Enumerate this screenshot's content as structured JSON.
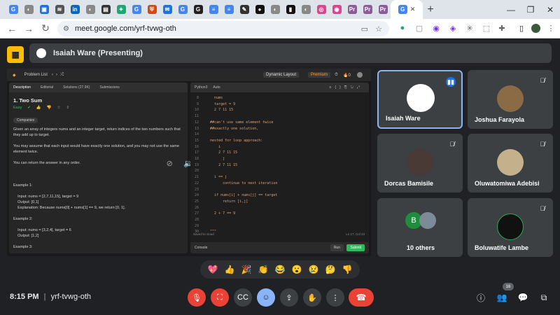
{
  "browser": {
    "tabs": [
      {
        "icon": "google-icon",
        "color": "#4285f4",
        "glyph": "G"
      },
      {
        "icon": "globe-icon",
        "color": "#888888",
        "glyph": "◐"
      },
      {
        "icon": "browser-icon",
        "color": "#1a73e8",
        "glyph": "▣"
      },
      {
        "icon": "wifi-icon",
        "color": "#555555",
        "glyph": "≋"
      },
      {
        "icon": "linkedin-icon",
        "color": "#0a66c2",
        "glyph": "in"
      },
      {
        "icon": "globe-icon",
        "color": "#888888",
        "glyph": "◐"
      },
      {
        "icon": "image-icon",
        "color": "#333333",
        "glyph": "▤"
      },
      {
        "icon": "sparkle-icon",
        "color": "#19a974",
        "glyph": "✦"
      },
      {
        "icon": "google-icon",
        "color": "#4285f4",
        "glyph": "G"
      },
      {
        "icon": "shield-icon",
        "color": "#d9480f",
        "glyph": "⛨"
      },
      {
        "icon": "mail-icon",
        "color": "#1a73e8",
        "glyph": "✉"
      },
      {
        "icon": "google-icon",
        "color": "#4285f4",
        "glyph": "G"
      },
      {
        "icon": "g-dark-icon",
        "color": "#222222",
        "glyph": "G"
      },
      {
        "icon": "docs-icon",
        "color": "#4285f4",
        "glyph": "≡"
      },
      {
        "icon": "sheets-icon",
        "color": "#4285f4",
        "glyph": "≡"
      },
      {
        "icon": "bookmark-icon",
        "color": "#333333",
        "glyph": "✎"
      },
      {
        "icon": "github-icon",
        "color": "#111111",
        "glyph": "●"
      },
      {
        "icon": "globe-icon",
        "color": "#888888",
        "glyph": "◐"
      },
      {
        "icon": "note-icon",
        "color": "#111111",
        "glyph": "▮"
      },
      {
        "icon": "globe-icon",
        "color": "#888888",
        "glyph": "◐"
      },
      {
        "icon": "pink-icon",
        "color": "#e83e8c",
        "glyph": "◎"
      },
      {
        "icon": "pink-icon",
        "color": "#e83e8c",
        "glyph": "◉"
      },
      {
        "icon": "pr-icon",
        "color": "#8e5b9a",
        "glyph": "Pr"
      },
      {
        "icon": "pr-icon",
        "color": "#8e5b9a",
        "glyph": "Pr"
      },
      {
        "icon": "pr-icon",
        "color": "#8e5b9a",
        "glyph": "Pr"
      }
    ],
    "url": "meet.google.com/yrf-tvwg-oth"
  },
  "meet": {
    "presenter_label": "Isaiah Ware (Presenting)",
    "meeting_code": "yrf-tvwg-oth",
    "time": "8:15 PM",
    "participant_count": "16",
    "participants": [
      {
        "name": "Isaiah Ware",
        "active": true
      },
      {
        "name": "Joshua Farayola"
      },
      {
        "name": "Dorcas Bamisile"
      },
      {
        "name": "Oluwatomiwa Adebisi"
      },
      {
        "name": "10 others"
      },
      {
        "name": "Boluwatife Lambe"
      }
    ],
    "reactions": [
      "💖",
      "👍",
      "🎉",
      "👏",
      "😂",
      "😮",
      "😢",
      "🤔",
      "👎"
    ]
  },
  "leetcode": {
    "problem_list": "Problem List",
    "layout_btn": "Dynamic Layout",
    "premium": "Premium",
    "left_tabs": [
      "Description",
      "Editorial",
      "Solutions (27.9K)",
      "Submissions"
    ],
    "title": "1. Two Sum",
    "difficulty": "Easy",
    "solved": "Solved",
    "companies": "Companies",
    "description": "Given an array of integers nums and an integer target, return indices of the two numbers such that\nthey add up to target.\n\nYou may assume that each input would have exactly one solution, and you may not use the same\nelement twice.\n\nYou can return the answer in any order.\n\n\n\nExample 1:\n\n    Input: nums = [2,7,11,15], target = 9\n    Output: [0,1]\n    Explanation: Because nums[0] + nums[1] == 9, we return [0, 1].\n\nExample 2:\n\n    Input: nums = [3,2,4], target = 6\n    Output: [1,2]\n\nExample 3:\n\n    Input: nums = [3,3], target = 6\n    Output: [0,1]",
    "language": "Python3",
    "auto": "Auto",
    "code_lines": [
      {
        "n": "8",
        "t": "      nums"
      },
      {
        "n": "9",
        "t": "      target = 9"
      },
      {
        "n": "10",
        "t": "      2 7 11 15"
      },
      {
        "n": "11",
        "t": ""
      },
      {
        "n": "12",
        "t": "    ##can't use same element twice"
      },
      {
        "n": "13",
        "t": "    ##exactly one solution,"
      },
      {
        "n": "14",
        "t": ""
      },
      {
        "n": "15",
        "t": "    nested for loop approach:"
      },
      {
        "n": "16",
        "t": "        i"
      },
      {
        "n": "17",
        "t": "        2 7 11 15"
      },
      {
        "n": "18",
        "t": "          j"
      },
      {
        "n": "19",
        "t": "        2 7 11 15"
      },
      {
        "n": "20",
        "t": ""
      },
      {
        "n": "21",
        "t": "      i == j"
      },
      {
        "n": "22",
        "t": "          continue to next iteration"
      },
      {
        "n": "23",
        "t": ""
      },
      {
        "n": "24",
        "t": "      if nums[i] + nums[j] == target"
      },
      {
        "n": "25",
        "t": "          return [i,j]"
      },
      {
        "n": "26",
        "t": ""
      },
      {
        "n": "27",
        "t": "      2 + 7 == 9"
      },
      {
        "n": "28",
        "t": ""
      },
      {
        "n": "29",
        "t": ""
      },
      {
        "n": "30",
        "t": "    \"\"\""
      }
    ],
    "saved": "Saved to cloud",
    "cursor": "Ln 17, Col 23",
    "console": "Console",
    "run": "Run",
    "submit": "Submit"
  }
}
